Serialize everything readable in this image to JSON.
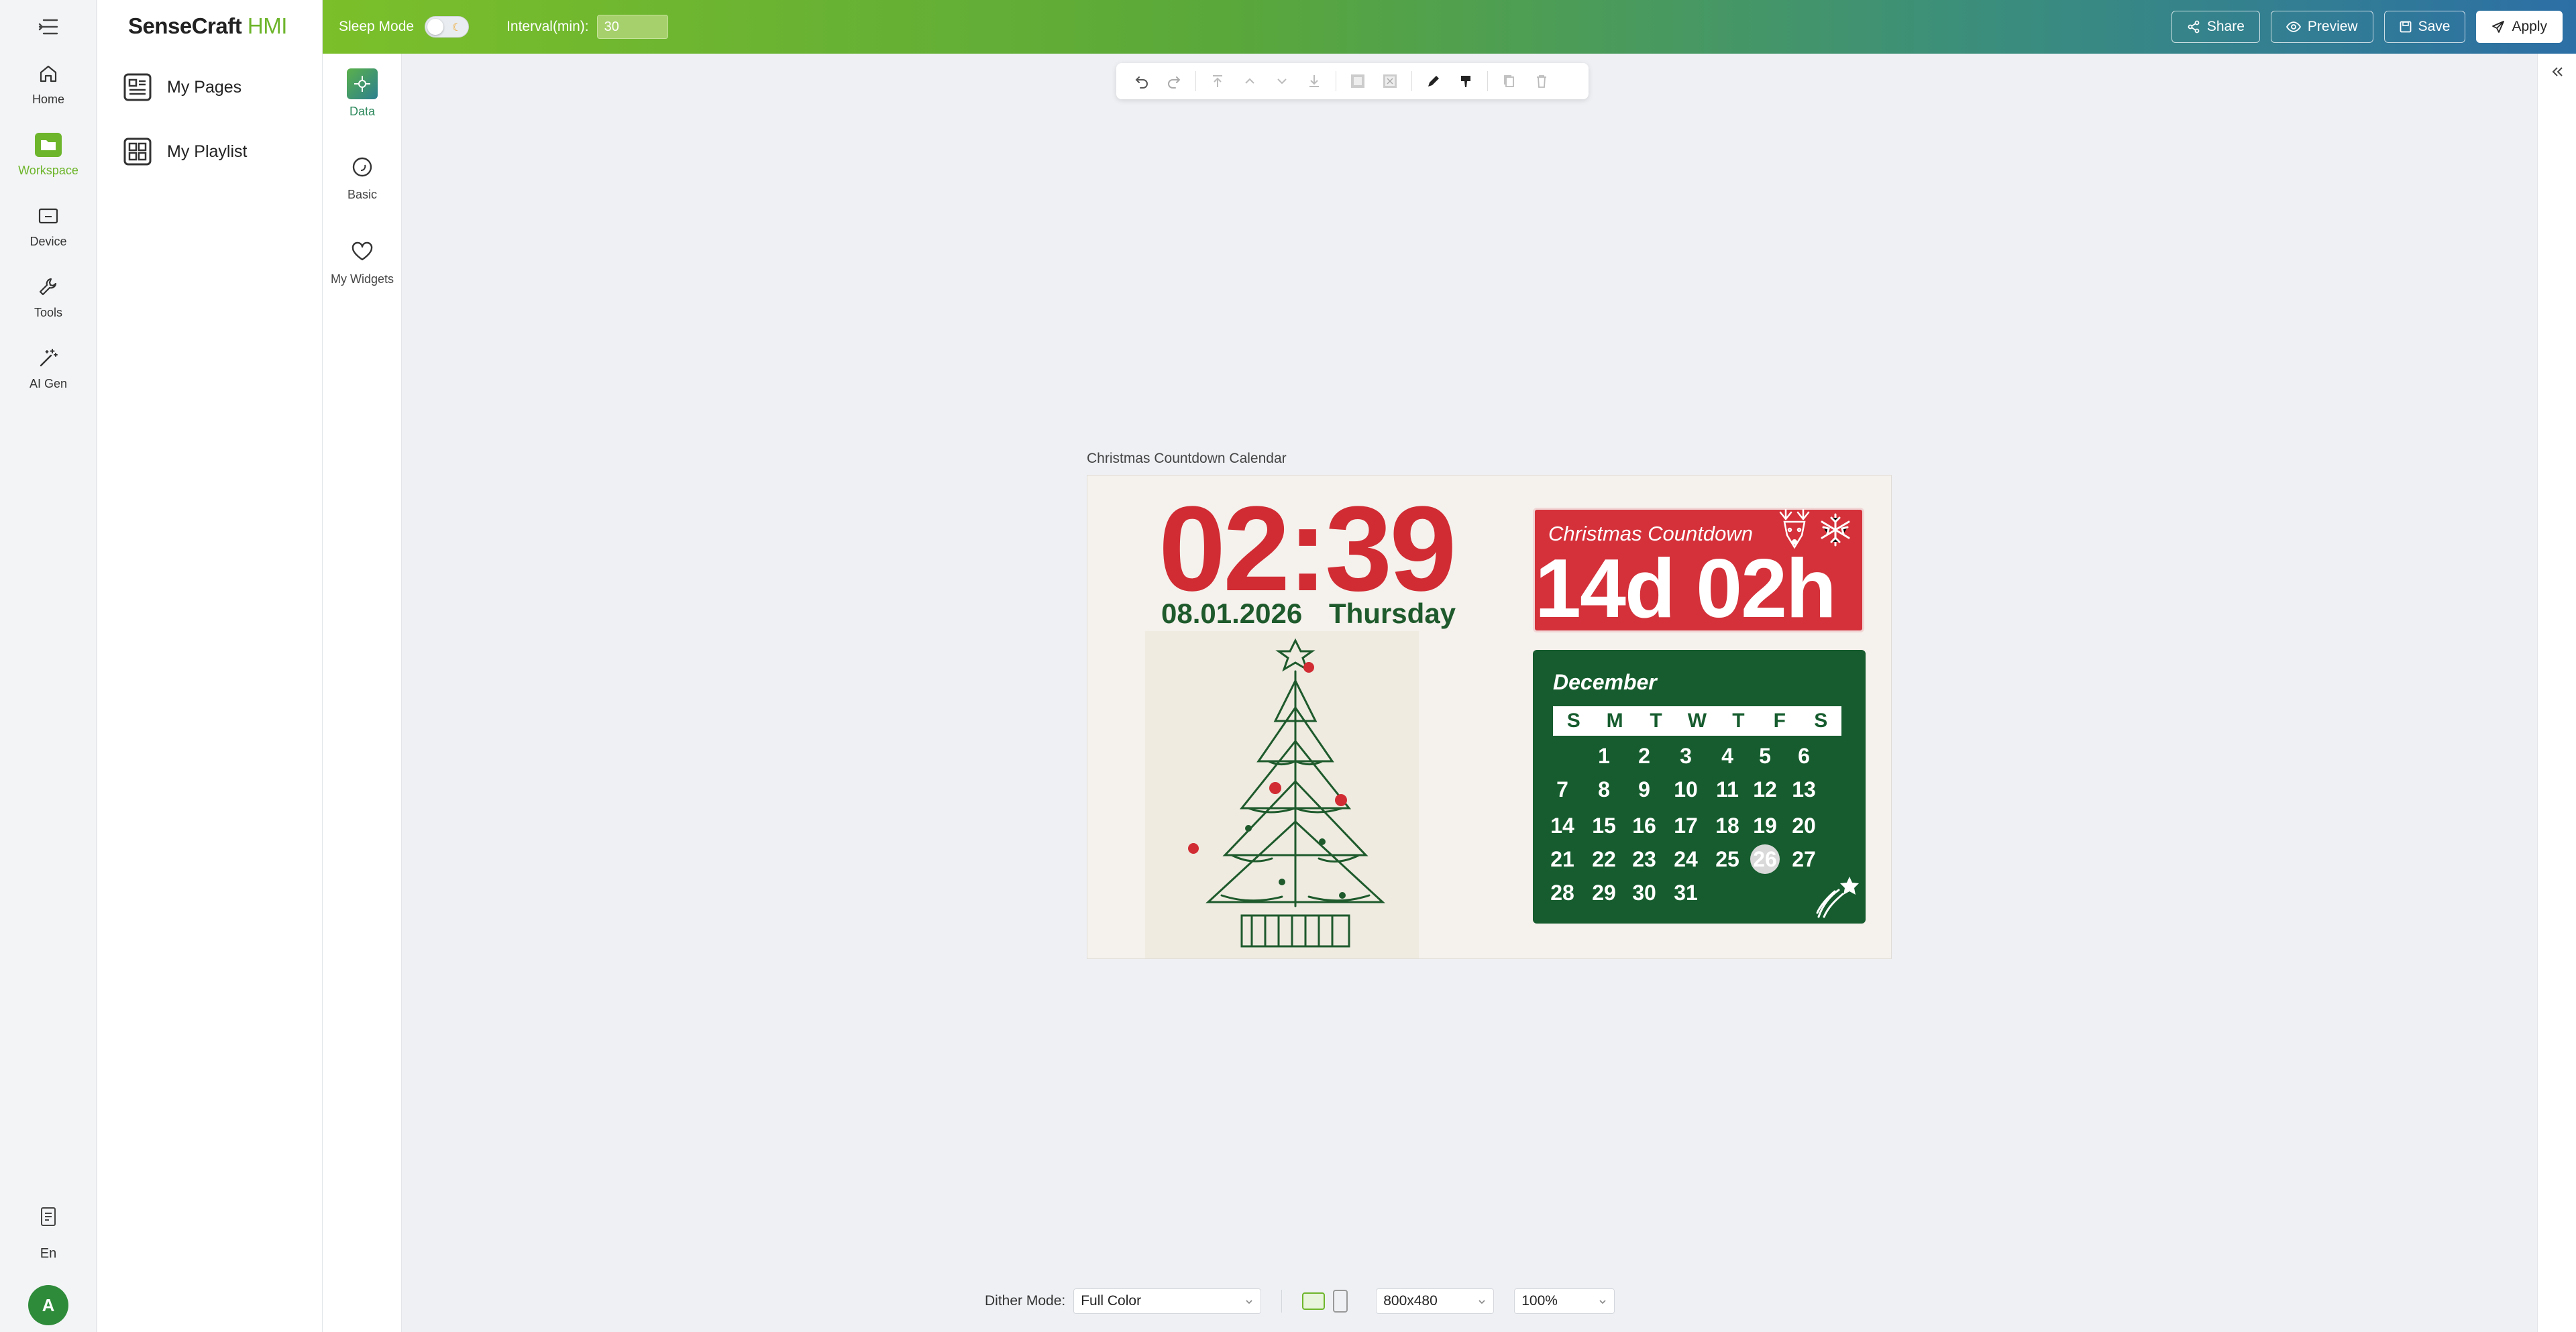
{
  "app": {
    "logo_main": "SenseCraft",
    "logo_accent": "HMI"
  },
  "rail": {
    "items": [
      {
        "label": "Home",
        "icon": "home-icon"
      },
      {
        "label": "Workspace",
        "icon": "folder-icon",
        "active": true
      },
      {
        "label": "Device",
        "icon": "device-icon"
      },
      {
        "label": "Tools",
        "icon": "wrench-icon"
      },
      {
        "label": "AI Gen",
        "icon": "magic-wand-icon"
      }
    ],
    "language": "En",
    "avatar_letter": "A"
  },
  "nav": {
    "items": [
      {
        "label": "My Pages",
        "icon": "pages-icon"
      },
      {
        "label": "My Playlist",
        "icon": "playlist-icon"
      }
    ]
  },
  "topbar": {
    "sleep_mode_label": "Sleep Mode",
    "sleep_mode_on": false,
    "interval_label": "Interval(min):",
    "interval_value": "30",
    "buttons": {
      "share": "Share",
      "preview": "Preview",
      "save": "Save",
      "apply": "Apply"
    }
  },
  "widgets": {
    "items": [
      {
        "label": "Data",
        "icon": "data-icon",
        "active": true
      },
      {
        "label": "Basic",
        "icon": "circle-icon"
      },
      {
        "label": "My Widgets",
        "icon": "heart-icon"
      }
    ]
  },
  "canvas": {
    "page_title": "Christmas Countdown Calendar",
    "time": "02:39",
    "date": "08.01.2026",
    "weekday": "Thursday",
    "countdown_title": "Christmas Countdown",
    "countdown_value": "14d 02h",
    "calendar": {
      "month": "December",
      "weekday_headers": [
        "S",
        "M",
        "T",
        "W",
        "T",
        "F",
        "S"
      ],
      "weeks": [
        [
          "",
          "1",
          "2",
          "3",
          "4",
          "5",
          "6"
        ],
        [
          "7",
          "8",
          "9",
          "10",
          "11",
          "12",
          "13"
        ],
        [
          "14",
          "15",
          "16",
          "17",
          "18",
          "19",
          "20"
        ],
        [
          "21",
          "22",
          "23",
          "24",
          "25",
          "26",
          "27"
        ],
        [
          "28",
          "29",
          "30",
          "31",
          "",
          "",
          ""
        ]
      ],
      "highlighted_day": "26"
    },
    "colors": {
      "red": "#d12c34",
      "green": "#165c2e",
      "brand": "#6db52b"
    }
  },
  "bottom": {
    "dither_label": "Dither Mode:",
    "dither_value": "Full Color",
    "resolution": "800x480",
    "zoom": "100%"
  }
}
